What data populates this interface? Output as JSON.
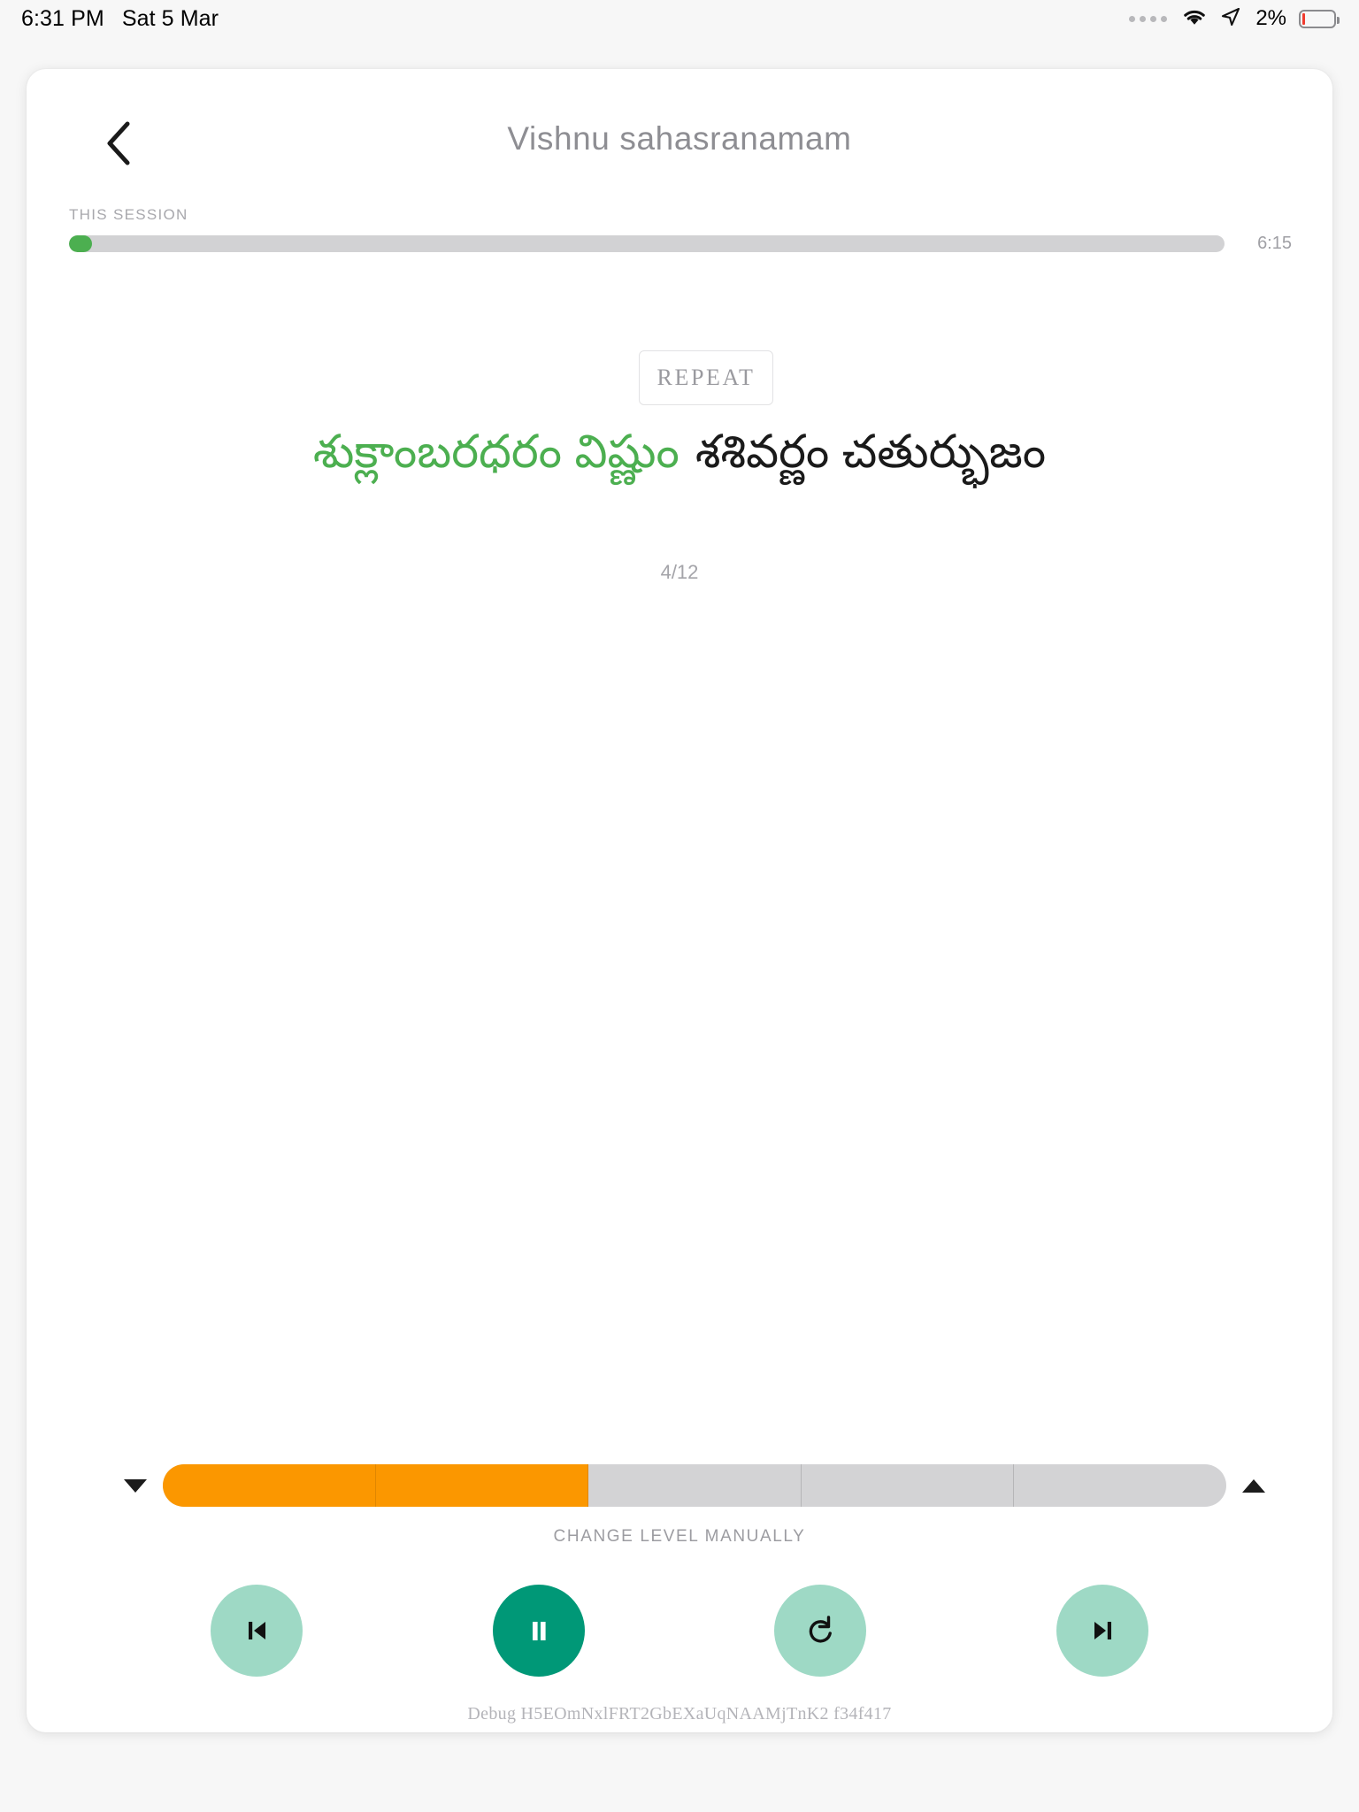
{
  "status_bar": {
    "time": "6:31 PM",
    "date": "Sat 5 Mar",
    "battery_percent": "2%",
    "icons": [
      "signal-dots-icon",
      "wifi-icon",
      "location-arrow-icon",
      "battery-icon"
    ]
  },
  "header": {
    "back_icon": "chevron-left-icon",
    "title": "Vishnu sahasranamam"
  },
  "session": {
    "label": "THIS SESSION",
    "elapsed_percent": 2,
    "total_time": "6:15"
  },
  "repeat": {
    "label": "REPEAT"
  },
  "verse": {
    "green_part": "శుక్లాంబరధరం విష్ణుం",
    "black_part": "శశివర్ణం చతుర్భుజం",
    "counter": "4/12"
  },
  "level": {
    "decrease_icon": "triangle-down-icon",
    "increase_icon": "triangle-up-icon",
    "total_segments": 5,
    "filled_segments": 2,
    "caption": "CHANGE LEVEL MANUALLY",
    "fill_color": "#fb9700",
    "track_color": "#d3d3d5"
  },
  "transport": {
    "buttons": [
      {
        "name": "previous-button",
        "icon": "skip-previous-icon",
        "primary": false
      },
      {
        "name": "pause-button",
        "icon": "pause-icon",
        "primary": true
      },
      {
        "name": "replay-button",
        "icon": "replay-icon",
        "primary": false
      },
      {
        "name": "next-button",
        "icon": "skip-next-icon",
        "primary": false
      }
    ],
    "accent_color": "#009877",
    "secondary_color": "#9ed9c5"
  },
  "debug": {
    "text": "Debug H5EOmNxlFRT2GbEXaUqNAAMjTnK2 f34f417"
  }
}
